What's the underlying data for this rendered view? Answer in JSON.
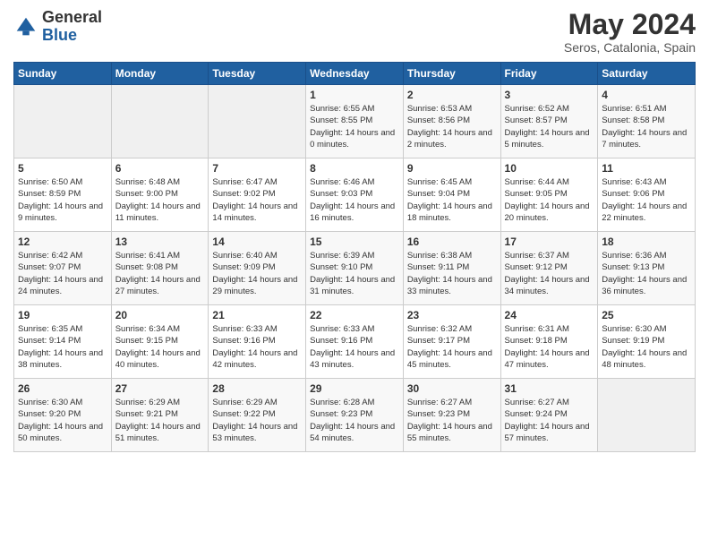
{
  "logo": {
    "general": "General",
    "blue": "Blue",
    "icon_color": "#2060a0"
  },
  "header": {
    "title": "May 2024",
    "subtitle": "Seros, Catalonia, Spain"
  },
  "days_of_week": [
    "Sunday",
    "Monday",
    "Tuesday",
    "Wednesday",
    "Thursday",
    "Friday",
    "Saturday"
  ],
  "weeks": [
    [
      {
        "day": "",
        "sunrise": "",
        "sunset": "",
        "daylight": ""
      },
      {
        "day": "",
        "sunrise": "",
        "sunset": "",
        "daylight": ""
      },
      {
        "day": "",
        "sunrise": "",
        "sunset": "",
        "daylight": ""
      },
      {
        "day": "1",
        "sunrise": "Sunrise: 6:55 AM",
        "sunset": "Sunset: 8:55 PM",
        "daylight": "Daylight: 14 hours and 0 minutes."
      },
      {
        "day": "2",
        "sunrise": "Sunrise: 6:53 AM",
        "sunset": "Sunset: 8:56 PM",
        "daylight": "Daylight: 14 hours and 2 minutes."
      },
      {
        "day": "3",
        "sunrise": "Sunrise: 6:52 AM",
        "sunset": "Sunset: 8:57 PM",
        "daylight": "Daylight: 14 hours and 5 minutes."
      },
      {
        "day": "4",
        "sunrise": "Sunrise: 6:51 AM",
        "sunset": "Sunset: 8:58 PM",
        "daylight": "Daylight: 14 hours and 7 minutes."
      }
    ],
    [
      {
        "day": "5",
        "sunrise": "Sunrise: 6:50 AM",
        "sunset": "Sunset: 8:59 PM",
        "daylight": "Daylight: 14 hours and 9 minutes."
      },
      {
        "day": "6",
        "sunrise": "Sunrise: 6:48 AM",
        "sunset": "Sunset: 9:00 PM",
        "daylight": "Daylight: 14 hours and 11 minutes."
      },
      {
        "day": "7",
        "sunrise": "Sunrise: 6:47 AM",
        "sunset": "Sunset: 9:02 PM",
        "daylight": "Daylight: 14 hours and 14 minutes."
      },
      {
        "day": "8",
        "sunrise": "Sunrise: 6:46 AM",
        "sunset": "Sunset: 9:03 PM",
        "daylight": "Daylight: 14 hours and 16 minutes."
      },
      {
        "day": "9",
        "sunrise": "Sunrise: 6:45 AM",
        "sunset": "Sunset: 9:04 PM",
        "daylight": "Daylight: 14 hours and 18 minutes."
      },
      {
        "day": "10",
        "sunrise": "Sunrise: 6:44 AM",
        "sunset": "Sunset: 9:05 PM",
        "daylight": "Daylight: 14 hours and 20 minutes."
      },
      {
        "day": "11",
        "sunrise": "Sunrise: 6:43 AM",
        "sunset": "Sunset: 9:06 PM",
        "daylight": "Daylight: 14 hours and 22 minutes."
      }
    ],
    [
      {
        "day": "12",
        "sunrise": "Sunrise: 6:42 AM",
        "sunset": "Sunset: 9:07 PM",
        "daylight": "Daylight: 14 hours and 24 minutes."
      },
      {
        "day": "13",
        "sunrise": "Sunrise: 6:41 AM",
        "sunset": "Sunset: 9:08 PM",
        "daylight": "Daylight: 14 hours and 27 minutes."
      },
      {
        "day": "14",
        "sunrise": "Sunrise: 6:40 AM",
        "sunset": "Sunset: 9:09 PM",
        "daylight": "Daylight: 14 hours and 29 minutes."
      },
      {
        "day": "15",
        "sunrise": "Sunrise: 6:39 AM",
        "sunset": "Sunset: 9:10 PM",
        "daylight": "Daylight: 14 hours and 31 minutes."
      },
      {
        "day": "16",
        "sunrise": "Sunrise: 6:38 AM",
        "sunset": "Sunset: 9:11 PM",
        "daylight": "Daylight: 14 hours and 33 minutes."
      },
      {
        "day": "17",
        "sunrise": "Sunrise: 6:37 AM",
        "sunset": "Sunset: 9:12 PM",
        "daylight": "Daylight: 14 hours and 34 minutes."
      },
      {
        "day": "18",
        "sunrise": "Sunrise: 6:36 AM",
        "sunset": "Sunset: 9:13 PM",
        "daylight": "Daylight: 14 hours and 36 minutes."
      }
    ],
    [
      {
        "day": "19",
        "sunrise": "Sunrise: 6:35 AM",
        "sunset": "Sunset: 9:14 PM",
        "daylight": "Daylight: 14 hours and 38 minutes."
      },
      {
        "day": "20",
        "sunrise": "Sunrise: 6:34 AM",
        "sunset": "Sunset: 9:15 PM",
        "daylight": "Daylight: 14 hours and 40 minutes."
      },
      {
        "day": "21",
        "sunrise": "Sunrise: 6:33 AM",
        "sunset": "Sunset: 9:16 PM",
        "daylight": "Daylight: 14 hours and 42 minutes."
      },
      {
        "day": "22",
        "sunrise": "Sunrise: 6:33 AM",
        "sunset": "Sunset: 9:16 PM",
        "daylight": "Daylight: 14 hours and 43 minutes."
      },
      {
        "day": "23",
        "sunrise": "Sunrise: 6:32 AM",
        "sunset": "Sunset: 9:17 PM",
        "daylight": "Daylight: 14 hours and 45 minutes."
      },
      {
        "day": "24",
        "sunrise": "Sunrise: 6:31 AM",
        "sunset": "Sunset: 9:18 PM",
        "daylight": "Daylight: 14 hours and 47 minutes."
      },
      {
        "day": "25",
        "sunrise": "Sunrise: 6:30 AM",
        "sunset": "Sunset: 9:19 PM",
        "daylight": "Daylight: 14 hours and 48 minutes."
      }
    ],
    [
      {
        "day": "26",
        "sunrise": "Sunrise: 6:30 AM",
        "sunset": "Sunset: 9:20 PM",
        "daylight": "Daylight: 14 hours and 50 minutes."
      },
      {
        "day": "27",
        "sunrise": "Sunrise: 6:29 AM",
        "sunset": "Sunset: 9:21 PM",
        "daylight": "Daylight: 14 hours and 51 minutes."
      },
      {
        "day": "28",
        "sunrise": "Sunrise: 6:29 AM",
        "sunset": "Sunset: 9:22 PM",
        "daylight": "Daylight: 14 hours and 53 minutes."
      },
      {
        "day": "29",
        "sunrise": "Sunrise: 6:28 AM",
        "sunset": "Sunset: 9:23 PM",
        "daylight": "Daylight: 14 hours and 54 minutes."
      },
      {
        "day": "30",
        "sunrise": "Sunrise: 6:27 AM",
        "sunset": "Sunset: 9:23 PM",
        "daylight": "Daylight: 14 hours and 55 minutes."
      },
      {
        "day": "31",
        "sunrise": "Sunrise: 6:27 AM",
        "sunset": "Sunset: 9:24 PM",
        "daylight": "Daylight: 14 hours and 57 minutes."
      },
      {
        "day": "",
        "sunrise": "",
        "sunset": "",
        "daylight": ""
      }
    ]
  ]
}
